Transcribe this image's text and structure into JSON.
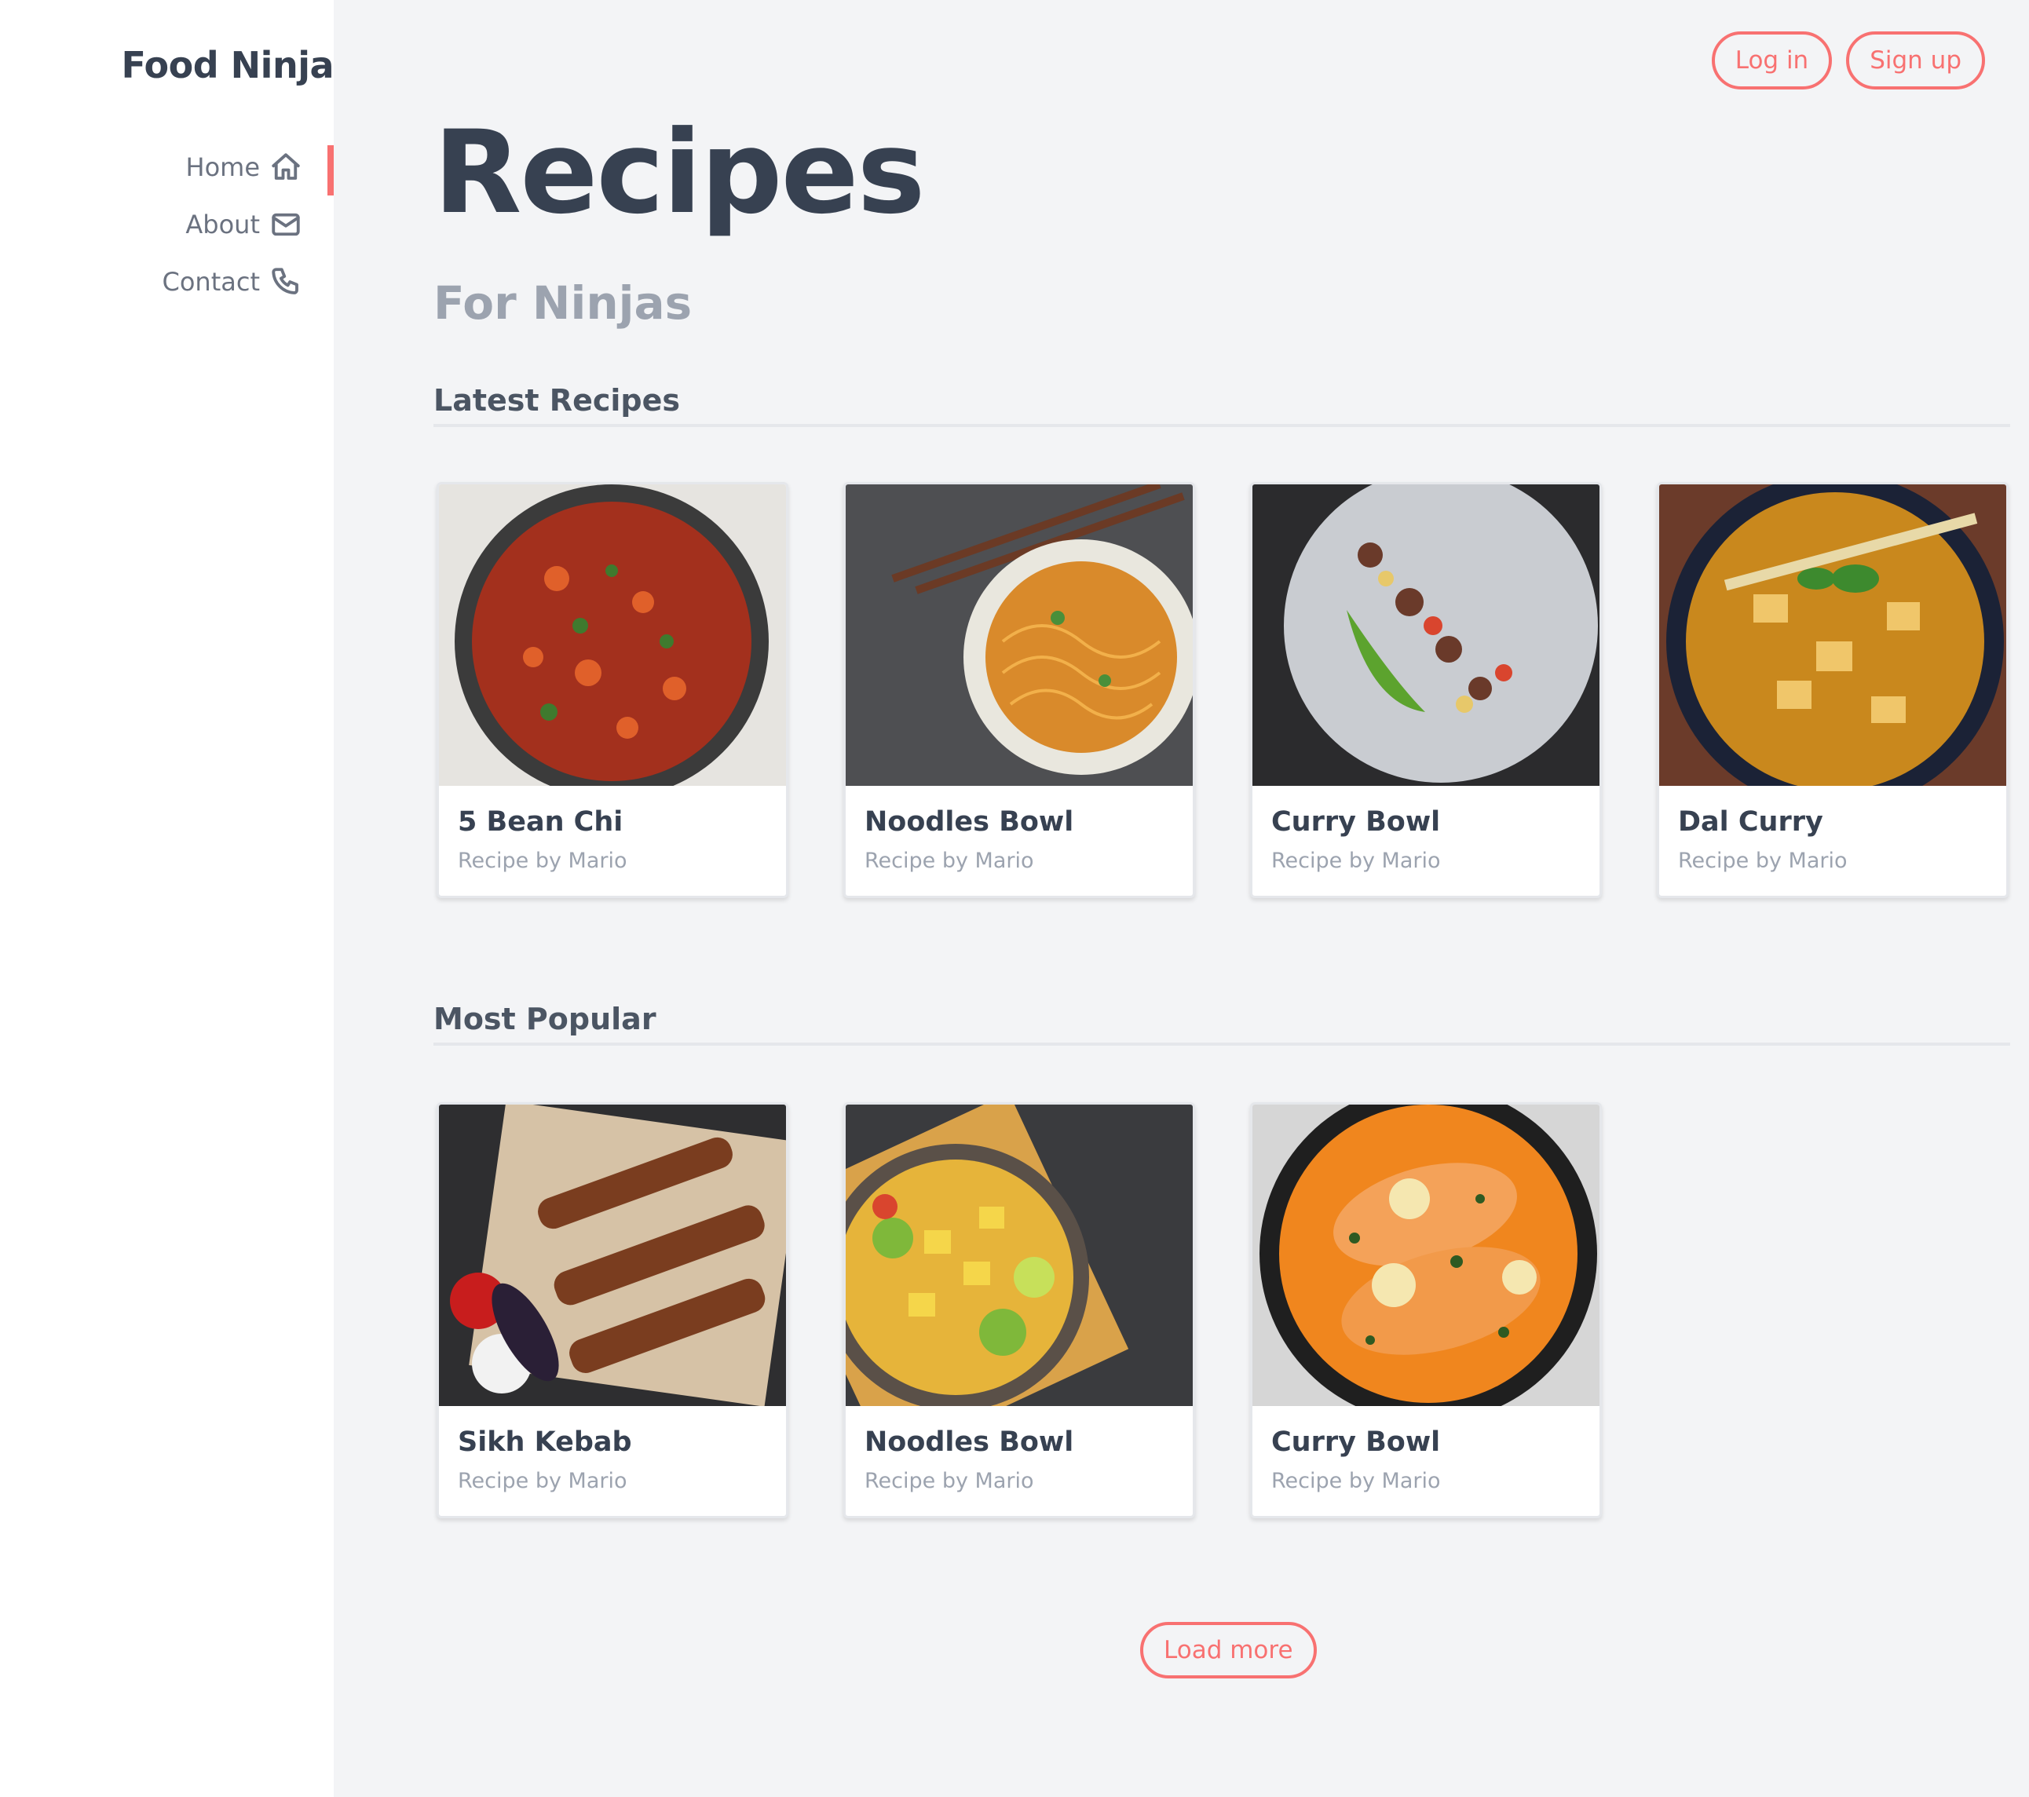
{
  "brand": "Food Ninja",
  "nav": [
    {
      "label": "Home",
      "icon": "home-icon",
      "active": true
    },
    {
      "label": "About",
      "icon": "mail-icon"
    },
    {
      "label": "Contact",
      "icon": "phone-icon"
    }
  ],
  "auth": {
    "login": "Log in",
    "signup": "Sign up"
  },
  "header": {
    "title": "Recipes",
    "subtitle": "For Ninjas"
  },
  "latest": {
    "heading": "Latest Recipes",
    "cards": [
      {
        "title": "5 Bean Chi",
        "author": "Recipe by Mario"
      },
      {
        "title": "Noodles Bowl",
        "author": "Recipe by Mario"
      },
      {
        "title": "Curry Bowl",
        "author": "Recipe by Mario"
      },
      {
        "title": "Dal Curry",
        "author": "Recipe by Mario"
      }
    ]
  },
  "popular": {
    "heading": "Most Popular",
    "cards": [
      {
        "title": "Sikh Kebab",
        "author": "Recipe by Mario"
      },
      {
        "title": "Noodles Bowl",
        "author": "Recipe by Mario"
      },
      {
        "title": "Curry Bowl",
        "author": "Recipe by Mario"
      }
    ]
  },
  "load_more": "Load more",
  "colors": {
    "accent": "#f87171",
    "background": "#f3f4f6",
    "text": "#374151"
  }
}
